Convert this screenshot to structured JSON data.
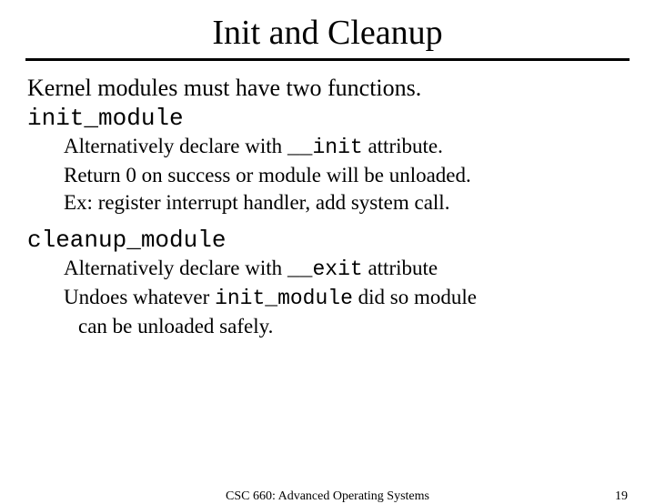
{
  "title": "Init and Cleanup",
  "intro": "Kernel modules must have two functions.",
  "init": {
    "name": "init_module",
    "alt_pre": "Alternatively declare with ",
    "alt_code": "__init",
    "alt_post": " attribute.",
    "ret": "Return 0 on success or module will be unloaded.",
    "ex": "Ex: register interrupt handler, add system call."
  },
  "cleanup": {
    "name": "cleanup_module",
    "alt_pre": "Alternatively declare with ",
    "alt_code": "__exit",
    "alt_post": " attribute",
    "undo_pre": "Undoes whatever ",
    "undo_code": "init_module",
    "undo_post": " did so module",
    "undo_cont": "can be unloaded safely."
  },
  "footer": {
    "course": "CSC 660: Advanced Operating Systems",
    "page": "19"
  }
}
